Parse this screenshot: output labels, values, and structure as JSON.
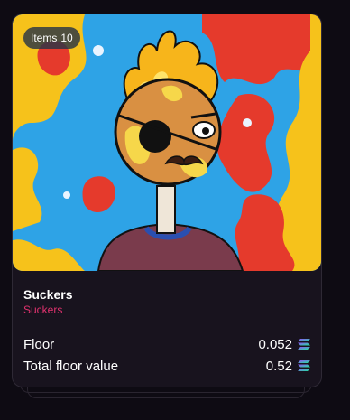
{
  "badge": {
    "label": "Items",
    "count": "10"
  },
  "collection": {
    "title": "Suckers",
    "subtitle": "Suckers"
  },
  "stats": [
    {
      "label": "Floor",
      "value": "0.052",
      "icon": "solana-icon"
    },
    {
      "label": "Total floor value",
      "value": "0.52",
      "icon": "solana-icon"
    }
  ],
  "colors": {
    "subtitle": "#e0326e",
    "card_bg": "#18131e",
    "page_bg": "#0e0b13"
  }
}
